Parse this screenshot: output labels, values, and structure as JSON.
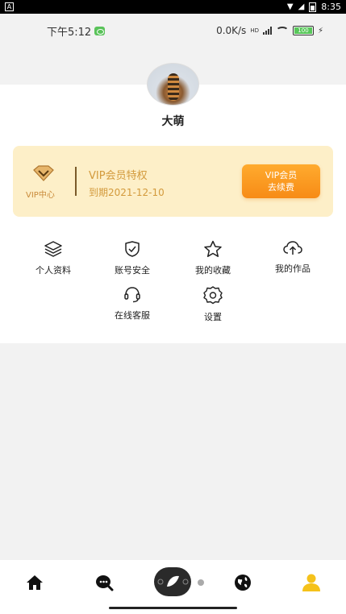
{
  "system_bar": {
    "notification_icon": "A",
    "time": "8:35",
    "icons": [
      "wifi-icon",
      "signal-icon",
      "battery-icon"
    ]
  },
  "phone_status": {
    "time": "下午5:12",
    "speed": "0.0K/s",
    "network": "HD",
    "battery": "100"
  },
  "profile": {
    "avatar": "tiger-avatar",
    "name": "大萌"
  },
  "vip": {
    "icon_label": "VIP中心",
    "title": "VIP会员特权",
    "expire": "到期2021-12-10",
    "button_line1": "VIP会员",
    "button_line2": "去续费",
    "accent": "#d39a3c",
    "card_bg": "#fdefc8",
    "button_color": "#f78b16"
  },
  "menu": {
    "items": [
      {
        "label": "个人资料",
        "icon": "layers-icon"
      },
      {
        "label": "账号安全",
        "icon": "shield-check-icon"
      },
      {
        "label": "我的收藏",
        "icon": "star-icon"
      },
      {
        "label": "我的作品",
        "icon": "cloud-upload-icon"
      },
      {
        "label": "在线客服",
        "icon": "headset-icon"
      },
      {
        "label": "设置",
        "icon": "gear-icon"
      }
    ]
  },
  "bottom_nav": {
    "items": [
      "home-icon",
      "search-chat-icon",
      "discover-icon",
      "globe-icon",
      "profile-icon"
    ],
    "active": "profile-icon",
    "active_color": "#f5c21b"
  }
}
